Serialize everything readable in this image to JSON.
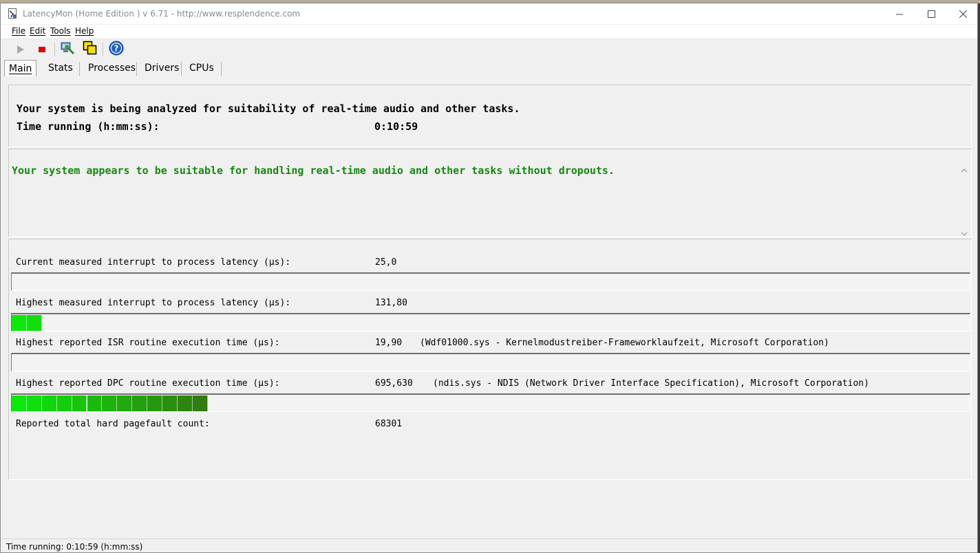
{
  "window": {
    "title": "LatencyMon  (Home Edition )  v 6.71 - http://www.resplendence.com"
  },
  "menu": [
    "File",
    "Edit",
    "Tools",
    "Help"
  ],
  "toolbar": {
    "icons": [
      "play-icon",
      "stop-icon",
      "process-icon",
      "windows-icon",
      "help-icon"
    ]
  },
  "tabs": [
    "Main",
    "Stats",
    "Processes",
    "Drivers",
    "CPUs"
  ],
  "header": {
    "line1": "Your system is being analyzed for suitability of real-time audio and other tasks.",
    "time_label": "Time running (h:mm:ss):",
    "time_value": "0:10:59"
  },
  "verdict": {
    "message": "Your system appears to be suitable for handling real-time audio and other tasks without dropouts.",
    "color": "#13890e"
  },
  "metrics": [
    {
      "label": "Current measured interrupt to process latency (µs):",
      "value": "25,0",
      "detail": "",
      "fill_segments": 0
    },
    {
      "label": "Highest measured interrupt to process latency (µs):",
      "value": "131,80",
      "detail": "",
      "fill_segments": 2
    },
    {
      "label": "Highest reported ISR routine execution time (µs):",
      "value": "19,90",
      "detail": "(Wdf01000.sys - Kernelmodustreiber-Frameworklaufzeit, Microsoft Corporation)",
      "fill_segments": 0
    },
    {
      "label": "Highest reported DPC routine execution time (µs):",
      "value": "695,630",
      "detail": "(ndis.sys - NDIS (Network Driver Interface Specification), Microsoft Corporation)",
      "fill_segments": 13
    }
  ],
  "pagefault": {
    "label": "Reported total hard pagefault count:",
    "value": "68301"
  },
  "status": {
    "text": "Time running: 0:10:59  (h:mm:ss)"
  }
}
